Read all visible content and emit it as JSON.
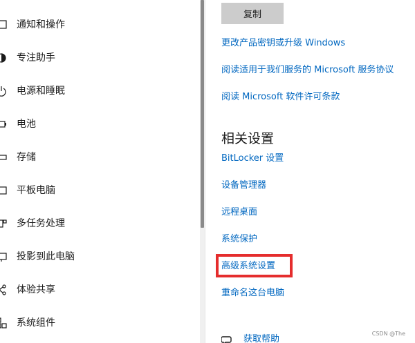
{
  "sidebar": {
    "items": [
      {
        "label": "通知和操作",
        "icon": "notification-icon"
      },
      {
        "label": "专注助手",
        "icon": "focus-assist-icon"
      },
      {
        "label": "电源和睡眠",
        "icon": "power-icon"
      },
      {
        "label": "电池",
        "icon": "battery-icon"
      },
      {
        "label": "存储",
        "icon": "storage-icon"
      },
      {
        "label": "平板电脑",
        "icon": "tablet-icon"
      },
      {
        "label": "多任务处理",
        "icon": "multitasking-icon"
      },
      {
        "label": "投影到此电脑",
        "icon": "projection-icon"
      },
      {
        "label": "体验共享",
        "icon": "share-icon"
      },
      {
        "label": "系统组件",
        "icon": "components-icon"
      }
    ]
  },
  "main": {
    "copy_button": "复制",
    "links_top": [
      "更改产品密钥或升级 Windows",
      "阅读适用于我们服务的 Microsoft 服务协议",
      "阅读 Microsoft 软件许可条款"
    ],
    "related_settings": {
      "title": "相关设置",
      "links": [
        "BitLocker 设置",
        "设备管理器",
        "远程桌面",
        "系统保护",
        "高级系统设置",
        "重命名这台电脑"
      ]
    },
    "help_link": "获取帮助"
  },
  "watermark": "CSDN @The",
  "colors": {
    "link": "#0067c0",
    "highlight": "#e52d2d",
    "button_bg": "#cccccc"
  }
}
